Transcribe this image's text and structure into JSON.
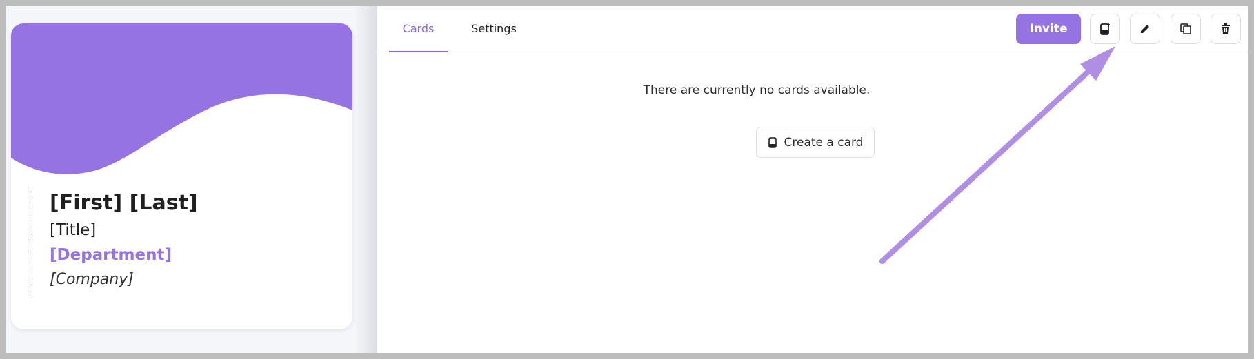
{
  "card": {
    "name": "[First] [Last]",
    "title": "[Title]",
    "department": "[Department]",
    "company": "[Company]"
  },
  "tabs": [
    {
      "label": "Cards",
      "active": true
    },
    {
      "label": "Settings",
      "active": false
    }
  ],
  "toolbar": {
    "invite_label": "Invite",
    "icons": [
      "phone-add-icon",
      "pencil-icon",
      "copy-icon",
      "trash-icon"
    ]
  },
  "main": {
    "empty_message": "There are currently no cards available.",
    "create_label": "Create a card"
  },
  "colors": {
    "accent": "#9673e3",
    "arrow": "#b08ee6"
  }
}
